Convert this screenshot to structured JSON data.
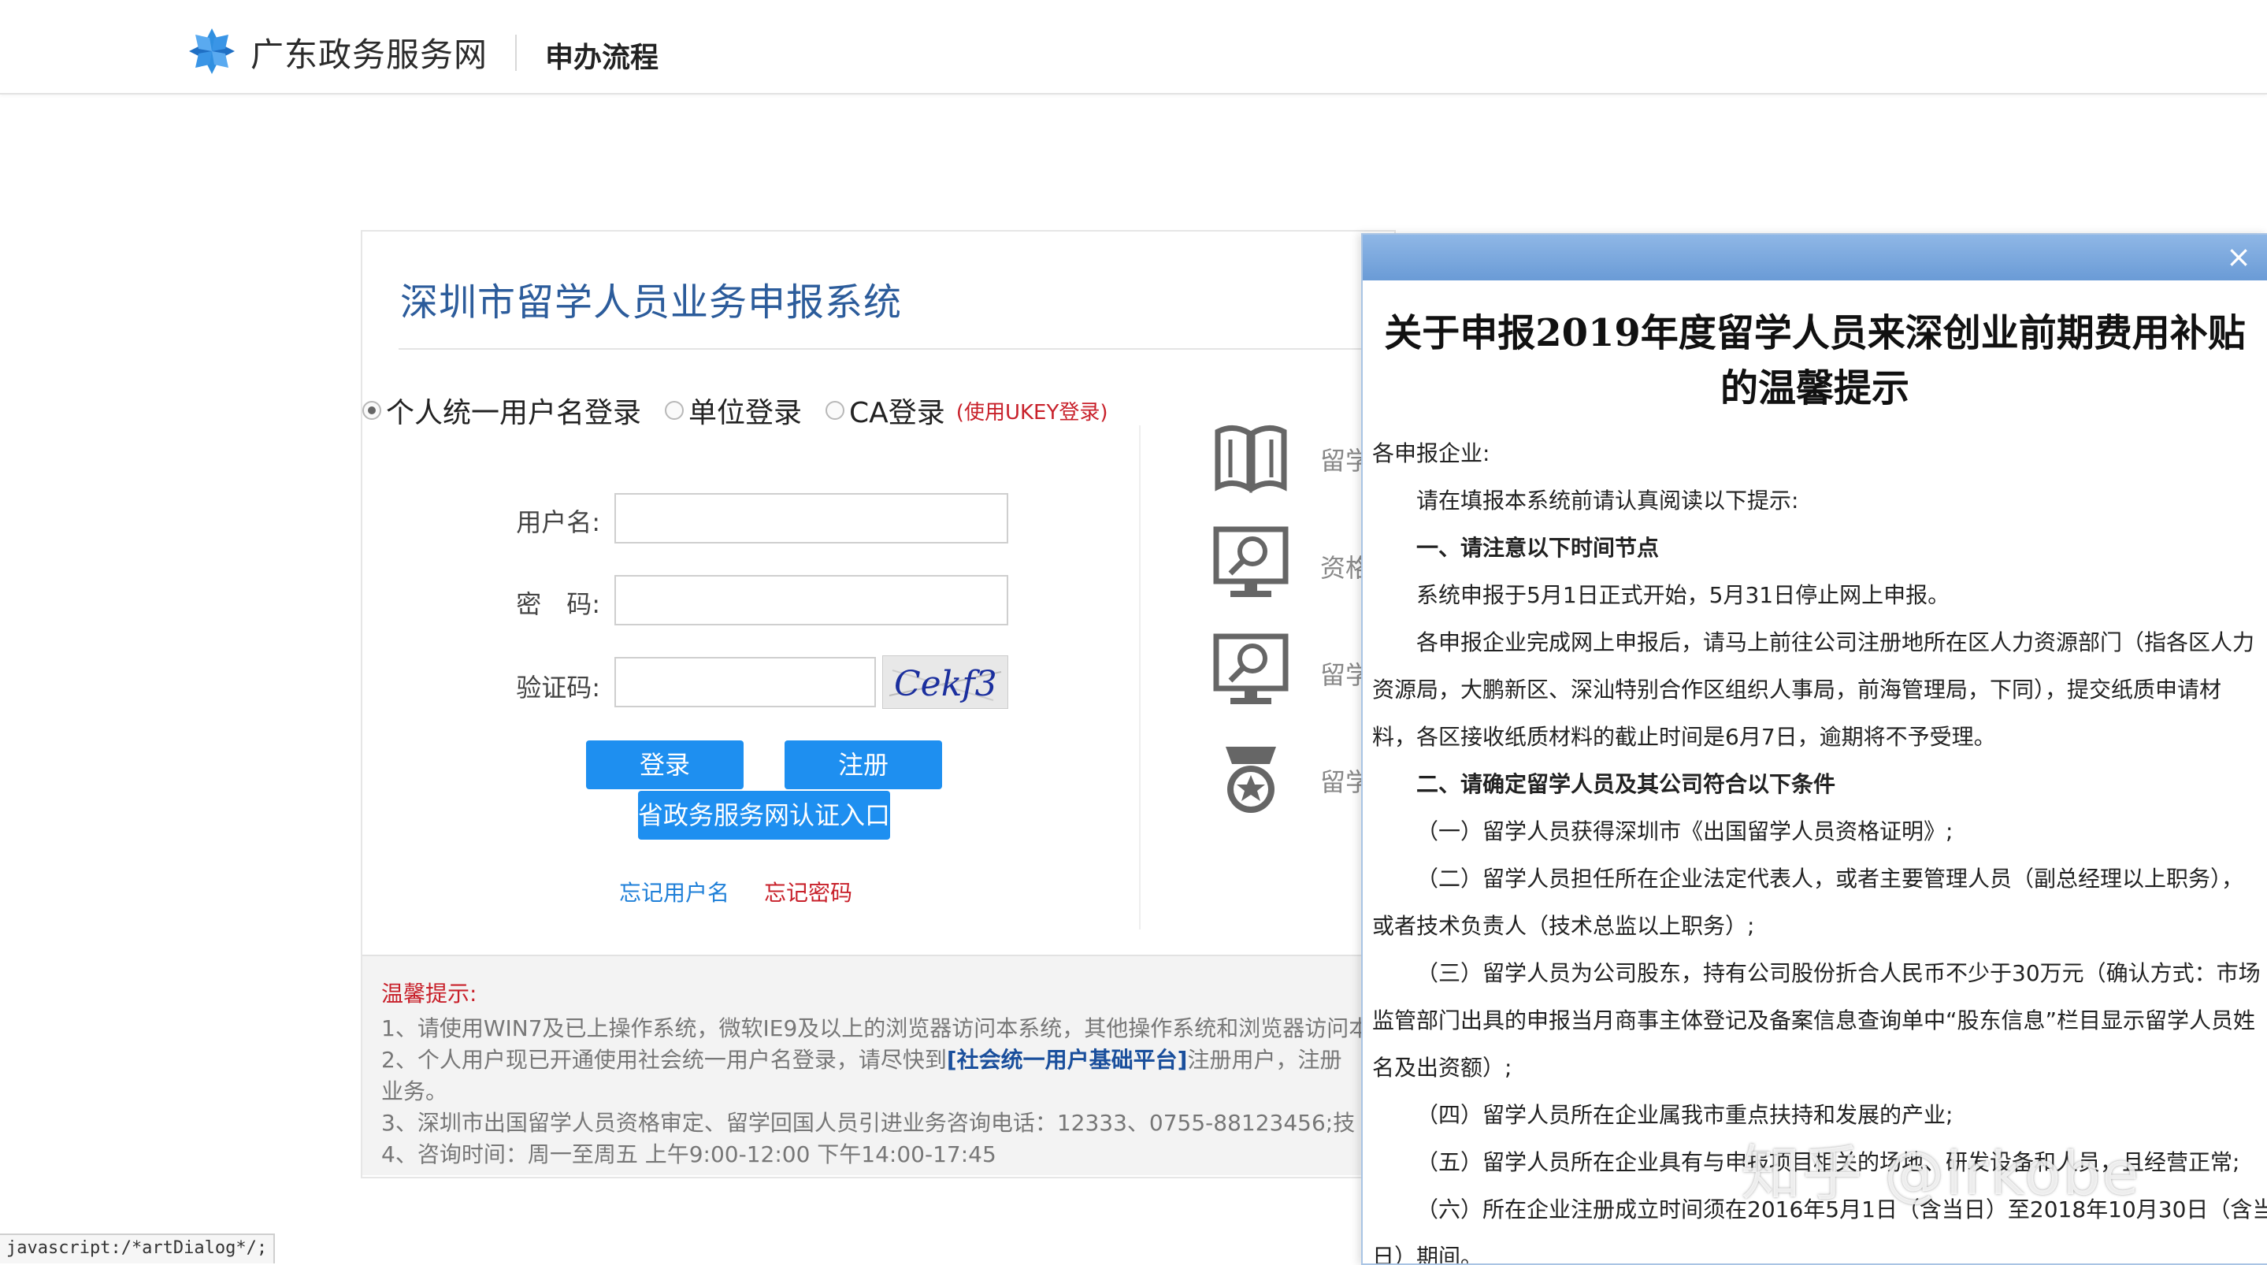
{
  "header": {
    "brand": "广东政务服务网",
    "subtitle": "申办流程"
  },
  "system": {
    "title": "深圳市留学人员业务申报系统"
  },
  "login": {
    "options": [
      "个人统一用户名登录",
      "单位登录",
      "CA登录"
    ],
    "selected": "个人统一用户名登录",
    "ca_note": "(使用UKEY登录)",
    "username_label": "用户名:",
    "password_label": "密　码:",
    "captcha_label": "验证码:",
    "captcha_text": "Cekf3",
    "login_button": "登录",
    "register_button": "注册",
    "province_button": "省政务服务网认证入口",
    "forgot_username": "忘记用户名",
    "forgot_password": "忘记密码"
  },
  "side_menu": [
    {
      "icon": "book-icon",
      "label": "留学"
    },
    {
      "icon": "monitor-search-icon",
      "label": "资格"
    },
    {
      "icon": "monitor-search-icon",
      "label": "留学"
    },
    {
      "icon": "award-icon",
      "label": "留学"
    }
  ],
  "tips": {
    "title": "温馨提示:",
    "line1": "1、请使用WIN7及已上操作系统，微软IE9及以上的浏览器访问本系统，其他操作系统和浏览器访问本",
    "line2_before": "2、个人用户现已开通使用社会统一用户名登录，请尽快到",
    "line2_link": "[社会统一用户基础平台]",
    "line2_after": "注册用户，注册",
    "line2b": "业务。",
    "line3": "3、深圳市出国留学人员资格审定、留学回国人员引进业务咨询电话：12333、0755-88123456;技",
    "line4": "4、咨询时间：周一至周五 上午9:00-12:00 下午14:00-17:45"
  },
  "status_bar": "javascript:/*artDialog*/;",
  "dialog": {
    "close": "×",
    "title_line1": "关于申报2019年度留学人员来深创业前期费用补贴",
    "title_line2": "的温馨提示",
    "greeting": "各申报企业:",
    "lines": [
      "请在填报本系统前请认真阅读以下提示:",
      "一、请注意以下时间节点",
      "系统申报于5月1日正式开始，5月31日停止网上申报。",
      "各申报企业完成网上申报后，请马上前往公司注册地所在区人力资源部门（指各区人力",
      "资源局，大鹏新区、深汕特别合作区组织人事局，前海管理局，下同），提交纸质申请材",
      "料，各区接收纸质材料的截止时间是6月7日，逾期将不予受理。",
      "二、请确定留学人员及其公司符合以下条件",
      "（一）留学人员获得深圳市《出国留学人员资格证明》;",
      "（二）留学人员担任所在企业法定代表人，或者主要管理人员（副总经理以上职务），",
      "或者技术负责人（技术总监以上职务）;",
      "（三）留学人员为公司股东，持有公司股份折合人民币不少于30万元（确认方式：市场",
      "监管部门出具的申报当月商事主体登记及备案信息查询单中“股东信息”栏目显示留学人员姓",
      "名及出资额）;",
      "（四）留学人员所在企业属我市重点扶持和发展的产业;",
      "（五）留学人员所在企业具有与申报项目相关的场地、研发设备和人员，且经营正常;",
      "（六）所在企业注册成立时间须在2016年5月1日（含当日）至2018年10月30日（含当",
      "日）期间。"
    ]
  },
  "watermark": "知乎 @lrkobe",
  "colors": {
    "accent": "#1e8ff0",
    "title_blue": "#2c5c9b",
    "warning_red": "#c8202a",
    "dialog_bar": "#7aa8de"
  }
}
